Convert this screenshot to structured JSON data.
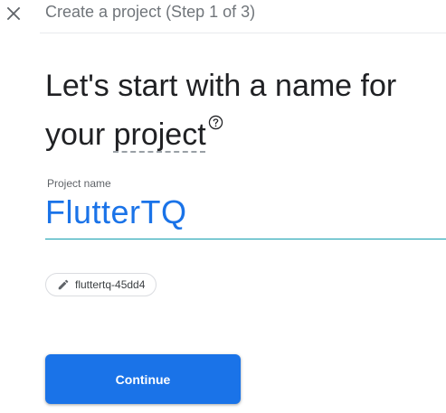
{
  "header": {
    "step_title": "Create a project (Step 1 of 3)",
    "close_icon": "close-icon"
  },
  "main": {
    "heading_line1": "Let's start with a name for",
    "heading_line2_prefix": "your ",
    "heading_line2_term": "project",
    "help_icon": "help-circle-icon",
    "name_field": {
      "label": "Project name",
      "value": "FlutterTQ"
    },
    "project_id_chip": {
      "icon": "pencil-icon",
      "value": "fluttertq-45dd4"
    },
    "continue_label": "Continue"
  },
  "colors": {
    "accent": "#1a73e8",
    "input_underline": "#129eaf",
    "title_text": "#202124",
    "muted_text": "#70757a"
  }
}
